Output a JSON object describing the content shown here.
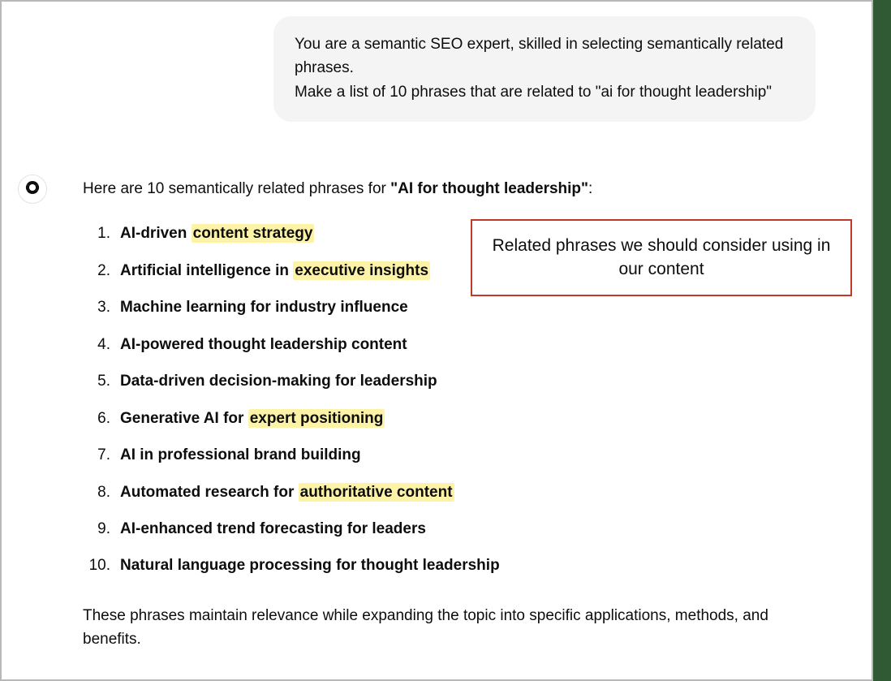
{
  "user_message": {
    "line1": "You are a semantic SEO expert, skilled in selecting semantically related phrases.",
    "line2": "Make a list of 10 phrases that are related to \"ai for thought leadership\""
  },
  "assistant": {
    "intro_prefix": "Here are 10 semantically related phrases for ",
    "intro_bold": "\"AI for thought leadership\"",
    "intro_suffix": ":",
    "phrases": [
      {
        "segments": [
          {
            "text": "AI-driven "
          },
          {
            "text": "content strategy",
            "hl": true
          }
        ]
      },
      {
        "segments": [
          {
            "text": "Artificial intelligence in "
          },
          {
            "text": "executive insights",
            "hl": true
          }
        ]
      },
      {
        "segments": [
          {
            "text": "Machine learning for industry influence"
          }
        ]
      },
      {
        "segments": [
          {
            "text": "AI-powered thought leadership content"
          }
        ]
      },
      {
        "segments": [
          {
            "text": "Data-driven decision-making for leadership"
          }
        ]
      },
      {
        "segments": [
          {
            "text": "Generative AI for "
          },
          {
            "text": "expert positioning",
            "hl": true
          }
        ]
      },
      {
        "segments": [
          {
            "text": "AI in professional brand building"
          }
        ]
      },
      {
        "segments": [
          {
            "text": "Automated research for "
          },
          {
            "text": "authoritative content",
            "hl": true
          }
        ]
      },
      {
        "segments": [
          {
            "text": "AI-enhanced trend forecasting for leaders"
          }
        ]
      },
      {
        "segments": [
          {
            "text": "Natural language processing for thought leadership"
          }
        ]
      }
    ],
    "closing": "These phrases maintain relevance while expanding the topic into specific applications, methods, and benefits."
  },
  "callout": "Related phrases we should consider using in our content",
  "icons": {
    "assistant_avatar": "openai-logo-icon"
  }
}
